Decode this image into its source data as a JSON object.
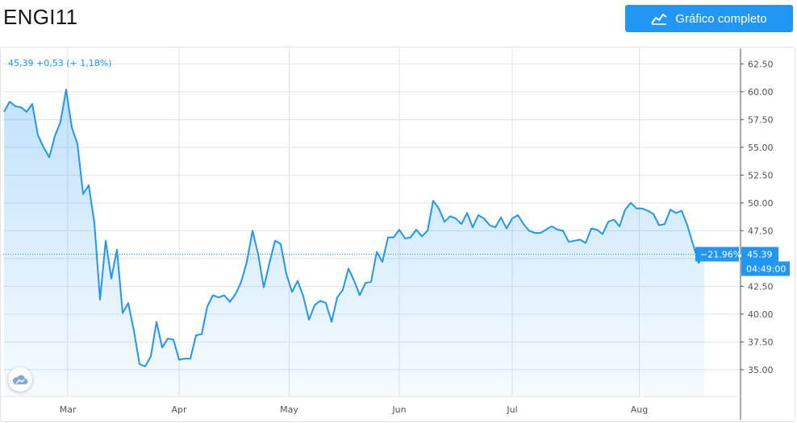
{
  "header": {
    "ticker": "ENGI11",
    "full_chart_label": "Gráfico completo"
  },
  "legend": {
    "price_change": "45,39 +0,53 (+ 1,18%)"
  },
  "last_value": {
    "change_pct": "−21.96%",
    "price": "45.39",
    "countdown": "04:49:00"
  },
  "colors": {
    "accent": "#2196f3",
    "line": "#2196f3",
    "grid": "#e0e3eb",
    "axis_text": "#50535e"
  },
  "icons": {
    "full_chart": "area-chart-icon",
    "logo": "cloud-logo-icon"
  },
  "chart_data": {
    "type": "area",
    "title": "",
    "xlabel": "",
    "ylabel": "",
    "x_tick_labels": [
      "Mar",
      "Apr",
      "May",
      "Jun",
      "Jul",
      "Aug"
    ],
    "y_tick_labels": [
      "35.00",
      "37.50",
      "40.00",
      "42.50",
      "45.00",
      "47.50",
      "50.00",
      "52.50",
      "55.00",
      "57.50",
      "60.00",
      "62.50"
    ],
    "ylim": [
      32.6,
      63.9
    ],
    "y_ticks": [
      35,
      37.5,
      40,
      42.5,
      45,
      47.5,
      50,
      52.5,
      55,
      57.5,
      60,
      62.5
    ],
    "grid": true,
    "baseline": 45.39,
    "series": [
      {
        "values": [
          58.2,
          59.1,
          58.7,
          58.6,
          58.2,
          58.9,
          56.1,
          55.0,
          54.1,
          56.0,
          57.3,
          60.2,
          56.8,
          55.3,
          50.8,
          51.6,
          48.2,
          41.3,
          46.6,
          43.2,
          45.8,
          40.1,
          41.0,
          38.5,
          35.5,
          35.3,
          36.2,
          39.3,
          37.0,
          37.8,
          37.7,
          35.9,
          36.0,
          36.0,
          38.1,
          38.2,
          40.7,
          41.7,
          41.5,
          41.7,
          41.1,
          41.8,
          42.9,
          44.7,
          47.5,
          45.4,
          42.4,
          44.6,
          46.6,
          46.3,
          43.6,
          42.0,
          43.0,
          41.6,
          39.5,
          40.8,
          41.2,
          41.0,
          39.3,
          41.5,
          42.2,
          44.1,
          43.0,
          41.7,
          42.8,
          42.9,
          45.6,
          44.7,
          46.9,
          46.9,
          47.6,
          46.8,
          46.9,
          47.6,
          47.0,
          47.5,
          50.2,
          49.5,
          48.3,
          48.8,
          48.6,
          48.1,
          49.1,
          47.8,
          48.9,
          48.6,
          48.0,
          47.8,
          48.7,
          47.7,
          48.6,
          48.9,
          48.1,
          47.5,
          47.3,
          47.3,
          47.6,
          47.9,
          47.6,
          47.5,
          46.5,
          46.6,
          46.7,
          46.4,
          47.7,
          47.6,
          47.2,
          48.3,
          48.5,
          47.9,
          49.4,
          50.0,
          49.5,
          49.5,
          49.3,
          49.0,
          48.0,
          48.1,
          49.4,
          49.1,
          49.3,
          48.0,
          46.3,
          44.6,
          45.4
        ],
        "x_month_positions": {
          "Mar": 11.3,
          "Apr": 31.0,
          "May": 50.5,
          "Jun": 70.0,
          "Jul": 90.0,
          "Aug": 112.5
        }
      }
    ]
  }
}
